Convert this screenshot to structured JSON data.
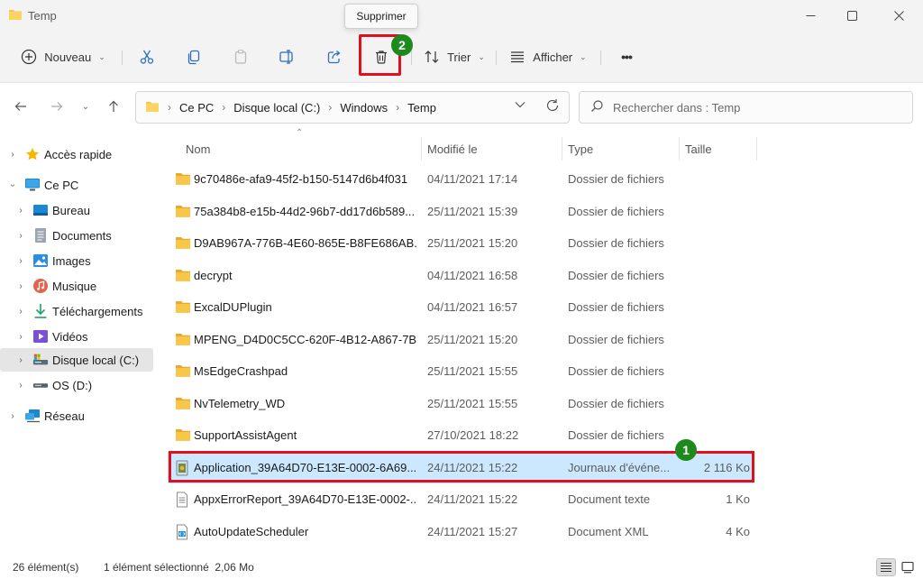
{
  "window": {
    "title": "Temp"
  },
  "tooltip": {
    "text": "Supprimer"
  },
  "toolbar": {
    "new_label": "Nouveau",
    "sort_label": "Trier",
    "view_label": "Afficher",
    "more_label": "•••"
  },
  "callouts": {
    "delete_step": "2",
    "row_step": "1"
  },
  "breadcrumb": [
    "Ce PC",
    "Disque local (C:)",
    "Windows",
    "Temp"
  ],
  "search": {
    "placeholder": "Rechercher dans : Temp"
  },
  "sidebar": {
    "items": [
      {
        "label": "Accès rapide",
        "icon": "star-icon"
      },
      {
        "label": "Ce PC",
        "icon": "computer-icon"
      },
      {
        "label": "Bureau",
        "icon": "desktop-icon"
      },
      {
        "label": "Documents",
        "icon": "documents-icon"
      },
      {
        "label": "Images",
        "icon": "pictures-icon"
      },
      {
        "label": "Musique",
        "icon": "music-icon"
      },
      {
        "label": "Téléchargements",
        "icon": "download-icon"
      },
      {
        "label": "Vidéos",
        "icon": "video-icon"
      },
      {
        "label": "Disque local (C:)",
        "icon": "drive-c-icon"
      },
      {
        "label": "OS (D:)",
        "icon": "drive-d-icon"
      },
      {
        "label": "Réseau",
        "icon": "network-icon"
      }
    ]
  },
  "columns": {
    "name": "Nom",
    "modified": "Modifié le",
    "type": "Type",
    "size": "Taille"
  },
  "files": [
    {
      "name": "9c70486e-afa9-45f2-b150-5147d6b4f031",
      "modified": "04/11/2021 17:14",
      "type": "Dossier de fichiers",
      "size": "",
      "icon": "folder-icon"
    },
    {
      "name": "75a384b8-e15b-44d2-96b7-dd17d6b589...",
      "modified": "25/11/2021 15:39",
      "type": "Dossier de fichiers",
      "size": "",
      "icon": "folder-icon"
    },
    {
      "name": "D9AB967A-776B-4E60-865E-B8FE686AB...",
      "modified": "25/11/2021 15:20",
      "type": "Dossier de fichiers",
      "size": "",
      "icon": "folder-icon"
    },
    {
      "name": "decrypt",
      "modified": "04/11/2021 16:58",
      "type": "Dossier de fichiers",
      "size": "",
      "icon": "folder-icon"
    },
    {
      "name": "ExcalDUPlugin",
      "modified": "04/11/2021 16:57",
      "type": "Dossier de fichiers",
      "size": "",
      "icon": "folder-icon"
    },
    {
      "name": "MPENG_D4D0C5CC-620F-4B12-A867-7B...",
      "modified": "25/11/2021 15:20",
      "type": "Dossier de fichiers",
      "size": "",
      "icon": "folder-icon"
    },
    {
      "name": "MsEdgeCrashpad",
      "modified": "25/11/2021 15:55",
      "type": "Dossier de fichiers",
      "size": "",
      "icon": "folder-icon"
    },
    {
      "name": "NvTelemetry_WD",
      "modified": "25/11/2021 15:55",
      "type": "Dossier de fichiers",
      "size": "",
      "icon": "folder-icon"
    },
    {
      "name": "SupportAssistAgent",
      "modified": "27/10/2021 18:22",
      "type": "Dossier de fichiers",
      "size": "",
      "icon": "folder-icon"
    },
    {
      "name": "Application_39A64D70-E13E-0002-6A69...",
      "modified": "24/11/2021 15:22",
      "type": "Journaux d'événe...",
      "size": "2 116 Ko",
      "icon": "event-log-icon"
    },
    {
      "name": "AppxErrorReport_39A64D70-E13E-0002-...",
      "modified": "24/11/2021 15:22",
      "type": "Document texte",
      "size": "1 Ko",
      "icon": "text-file-icon"
    },
    {
      "name": "AutoUpdateScheduler",
      "modified": "24/11/2021 15:27",
      "type": "Document XML",
      "size": "4 Ko",
      "icon": "xml-file-icon"
    }
  ],
  "status": {
    "count": "26 élément(s)",
    "selection": "1 élément sélectionné  2,06 Mo"
  },
  "colors": {
    "selection": "#cce8ff",
    "highlight": "#e0101e",
    "badge": "#1e8a1e",
    "folder": "#f8c74a"
  }
}
